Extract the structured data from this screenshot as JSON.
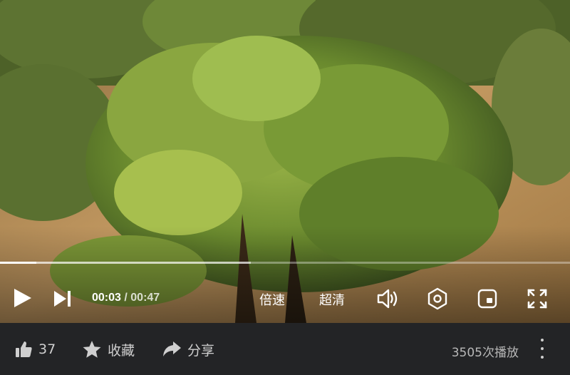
{
  "player": {
    "progress_fraction": 0.064,
    "buffered_fraction": 0.44,
    "current_time": "00:03",
    "separator": "/",
    "total_time": "00:47",
    "speed_label": "倍速",
    "quality_label": "超清",
    "icons": {
      "play": "play-icon",
      "next": "skip-next-icon",
      "volume": "volume-icon",
      "settings": "settings-icon",
      "pip": "picture-in-picture-icon",
      "fullscreen": "fullscreen-icon"
    }
  },
  "actions": {
    "like_count": "37",
    "favorite_label": "收藏",
    "share_label": "分享"
  },
  "play_count": "3505次播放",
  "colors": {
    "bar_background": "#232426",
    "foliage": "#5f7f2a",
    "soil": "#c49a62"
  }
}
